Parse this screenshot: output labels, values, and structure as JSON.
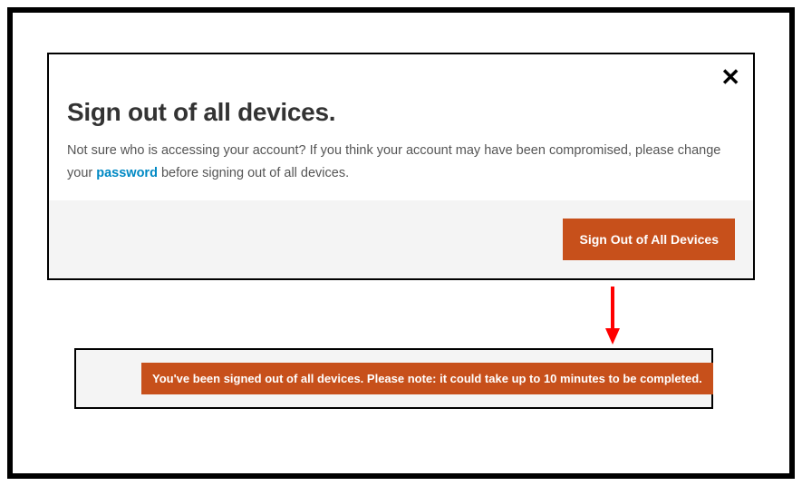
{
  "dialog": {
    "title": "Sign out of all devices.",
    "text_before_link": "Not sure who is accessing your account? If you think your account may have been compromised, please change your ",
    "link_label": "password",
    "text_after_link": " before signing out of all devices.",
    "button_label": "Sign Out of All Devices",
    "close_label": "✕"
  },
  "toast": {
    "message": "You've been signed out of all devices. Please note: it could take up to 10 minutes to be completed."
  }
}
